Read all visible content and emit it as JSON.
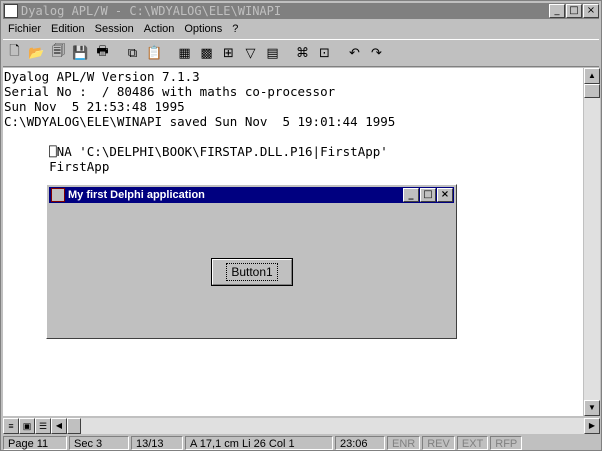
{
  "window": {
    "title": "Dyalog APL/W - C:\\WDYALOG\\ELE\\WINAPI"
  },
  "menu": [
    "Fichier",
    "Edition",
    "Session",
    "Action",
    "Options",
    "?"
  ],
  "session": {
    "lines": [
      "Dyalog APL/W Version 7.1.3",
      "Serial No :  / 80486 with maths co-processor",
      "Sun Nov  5 21:53:48 1995",
      "C:\\WDYALOG\\ELE\\WINAPI saved Sun Nov  5 19:01:44 1995",
      "",
      "      ⎕NA 'C:\\DELPHI\\BOOK\\FIRSTAP.DLL.P16|FirstApp'",
      "      FirstApp"
    ]
  },
  "dialog": {
    "title": "My first Delphi application",
    "button_label": "Button1"
  },
  "status": {
    "page": "Page 11",
    "sec": "Sec 3",
    "pages": "13/13",
    "position": "A  17,1 cm  Li 26   Col 1",
    "time": "23:06",
    "enr": "ENR",
    "rev": "REV",
    "ext": "EXT",
    "rfp": "RFP"
  }
}
